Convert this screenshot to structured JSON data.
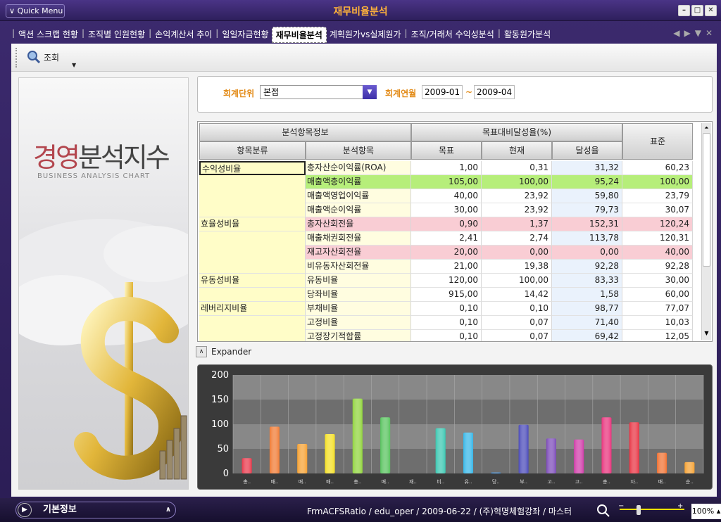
{
  "window": {
    "title": "재무비율분석",
    "quick_menu": "Quick Menu",
    "controls": {
      "minimize": "–",
      "maximize": "□",
      "close": "✕"
    }
  },
  "tabs": [
    {
      "label": "액션 스크랩 현황",
      "active": false
    },
    {
      "label": "조직별 인원현황",
      "active": false
    },
    {
      "label": "손익계산서 추이",
      "active": false
    },
    {
      "label": "일일자금현황",
      "active": false
    },
    {
      "label": "재무비율분석",
      "active": true
    },
    {
      "label": "계획원가vs실제원가",
      "active": false
    },
    {
      "label": "조직/거래처 수익성분석",
      "active": false
    },
    {
      "label": "활동원가분석",
      "active": false
    }
  ],
  "toolbar": {
    "search_label": "조회"
  },
  "left_panel": {
    "title_part1": "경영",
    "title_part2": "분석지수",
    "subtitle": "BUSINESS ANALYSIS CHART"
  },
  "conditions": {
    "unit_label": "회계단위",
    "unit_value": "본점",
    "period_label": "회계연월",
    "from": "2009-01",
    "to": "2009-04",
    "tilde": "~"
  },
  "grid": {
    "group_headers": {
      "info": "분석항목정보",
      "achieve": "목표대비달성율(%)",
      "standard": "표준"
    },
    "columns": {
      "category": "항목분류",
      "item": "분석항목",
      "target": "목표",
      "current": "현재",
      "rate": "달성율"
    },
    "rows": [
      {
        "category": "수익성비율",
        "item": "총자산순이익률(ROA)",
        "target": "1,00",
        "current": "0,31",
        "rate": "31,32",
        "standard": "60,23",
        "hl": ""
      },
      {
        "category": "",
        "item": "매출액총이익률",
        "target": "105,00",
        "current": "100,00",
        "rate": "95,24",
        "standard": "100,00",
        "hl": "green"
      },
      {
        "category": "",
        "item": "매출액영업이익률",
        "target": "40,00",
        "current": "23,92",
        "rate": "59,80",
        "standard": "23,79",
        "hl": ""
      },
      {
        "category": "",
        "item": "매출액순이익률",
        "target": "30,00",
        "current": "23,92",
        "rate": "79,73",
        "standard": "30,07",
        "hl": ""
      },
      {
        "category": "효율성비율",
        "item": "총자산회전율",
        "target": "0,90",
        "current": "1,37",
        "rate": "152,31",
        "standard": "120,24",
        "hl": "pink"
      },
      {
        "category": "",
        "item": "매출채권회전율",
        "target": "2,41",
        "current": "2,74",
        "rate": "113,78",
        "standard": "120,31",
        "hl": ""
      },
      {
        "category": "",
        "item": "재고자산회전율",
        "target": "20,00",
        "current": "0,00",
        "rate": "0,00",
        "standard": "40,00",
        "hl": "pink"
      },
      {
        "category": "",
        "item": "비유동자산회전율",
        "target": "21,00",
        "current": "19,38",
        "rate": "92,28",
        "standard": "92,28",
        "hl": ""
      },
      {
        "category": "유동성비율",
        "item": "유동비율",
        "target": "120,00",
        "current": "100,00",
        "rate": "83,33",
        "standard": "30,00",
        "hl": ""
      },
      {
        "category": "",
        "item": "당좌비율",
        "target": "915,00",
        "current": "14,42",
        "rate": "1,58",
        "standard": "60,00",
        "hl": ""
      },
      {
        "category": "레버리지비율",
        "item": "부채비율",
        "target": "0,10",
        "current": "0,10",
        "rate": "98,77",
        "standard": "77,07",
        "hl": ""
      },
      {
        "category": "",
        "item": "고정비율",
        "target": "0,10",
        "current": "0,07",
        "rate": "71,40",
        "standard": "10,03",
        "hl": ""
      },
      {
        "category": "",
        "item": "고정장기적합률",
        "target": "0,10",
        "current": "0,07",
        "rate": "69,42",
        "standard": "12,05",
        "hl": ""
      }
    ]
  },
  "expander": {
    "label": "Expander"
  },
  "chart_data": {
    "type": "bar",
    "categories": [
      "총..",
      "매..",
      "매..",
      "매..",
      "총..",
      "매..",
      "재..",
      "비..",
      "유..",
      "당..",
      "부..",
      "고..",
      "고..",
      "총..",
      "자..",
      "매..",
      "순.."
    ],
    "values": [
      31,
      95,
      60,
      80,
      152,
      114,
      0,
      92,
      83,
      2,
      99,
      71,
      69,
      114,
      104,
      42,
      23
    ],
    "colors": [
      "#e8374a",
      "#f07830",
      "#f5a030",
      "#f5e020",
      "#8fd43a",
      "#56c25c",
      "#3fc0a0",
      "#38c6b0",
      "#35b6e8",
      "#3a8fe0",
      "#4848b8",
      "#7a48b8",
      "#d03aa8",
      "#e8307a",
      "#e83040",
      "#f07030",
      "#f5a030"
    ],
    "ylim": [
      0,
      200
    ],
    "yticks": [
      0,
      50,
      100,
      150,
      200
    ],
    "grid": true
  },
  "status": {
    "basic_label": "기본정보",
    "text": "FrmACFSRatio / edu_oper / 2009-06-22 / (주)혁명체험강좌 / 마스터",
    "zoom": "100%"
  }
}
